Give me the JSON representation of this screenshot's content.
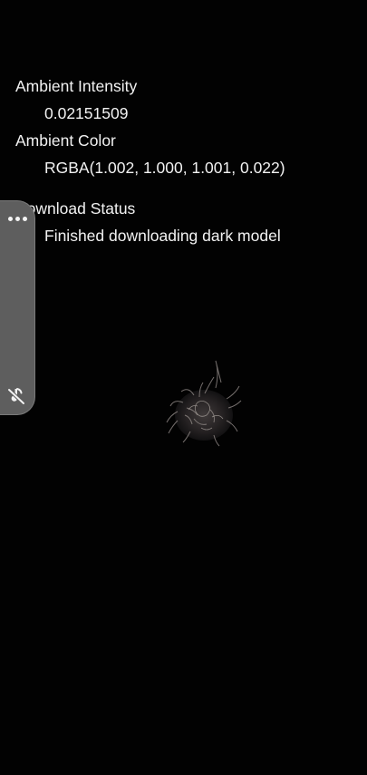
{
  "info": {
    "ambient_intensity_label": "Ambient Intensity",
    "ambient_intensity_value": "0.02151509",
    "ambient_color_label": "Ambient Color",
    "ambient_color_value": "RGBA(1.002, 1.000, 1.001, 0.022)",
    "download_status_label": "Download Status",
    "download_status_value": "Finished downloading dark model"
  },
  "side_handle": {
    "menu_icon": "more-horizontal-icon",
    "mute_icon": "muted-music-icon"
  },
  "model": {
    "description_icon": "sea-urchin-model"
  },
  "colors": {
    "background": "#020202",
    "text": "#f2f2f2",
    "handle": "#5e5e5e"
  }
}
